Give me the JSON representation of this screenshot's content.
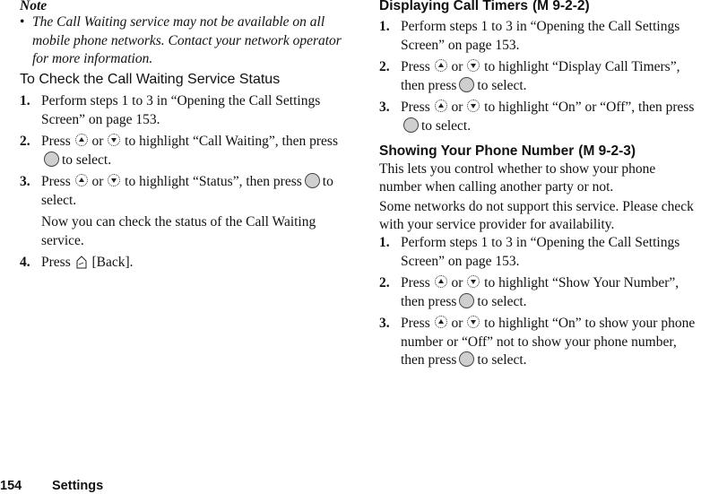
{
  "note": {
    "title": "Note",
    "bullet": "•",
    "text": "The Call Waiting service may not be available on all mobile phone networks. Contact your network operator for more information."
  },
  "left_section": {
    "heading": "To Check the Call Waiting Service Status",
    "steps": [
      {
        "num": "1.",
        "text": "Perform steps 1 to 3 in “Opening the Call Settings Screen” on page 153."
      },
      {
        "num": "2.",
        "pre": "Press",
        "or": "or",
        "mid": "to highlight “Call Waiting”, then press",
        "post": "to select."
      },
      {
        "num": "3.",
        "pre": "Press",
        "or": "or",
        "mid": "to highlight “Status”, then press",
        "post": "to select.",
        "sub": "Now you can check the status of the Call Waiting service."
      },
      {
        "num": "4.",
        "pre": "Press",
        "post": "[Back]."
      }
    ]
  },
  "right_section_1": {
    "heading": "Displaying Call Timers",
    "menu_ref": "(M 9-2-2)",
    "steps": [
      {
        "num": "1.",
        "text": "Perform steps 1 to 3 in “Opening the Call Settings Screen” on page 153."
      },
      {
        "num": "2.",
        "pre": "Press",
        "or": "or",
        "mid": "to highlight “Display Call Timers”, then press",
        "post": "to select."
      },
      {
        "num": "3.",
        "pre": "Press",
        "or": "or",
        "mid": "to highlight “On” or “Off”, then press",
        "post": "to select."
      }
    ]
  },
  "right_section_2": {
    "heading": "Showing Your Phone Number",
    "menu_ref": "(M 9-2-3)",
    "paragraphs": [
      "This lets you control whether to show your phone number when calling another party or not.",
      "Some networks do not support this service. Please check with your service provider for availability."
    ],
    "steps": [
      {
        "num": "1.",
        "text": "Perform steps 1 to 3 in “Opening the Call Settings Screen” on page 153."
      },
      {
        "num": "2.",
        "pre": "Press",
        "or": "or",
        "mid": "to highlight “Show Your Number”, then press",
        "post": "to select."
      },
      {
        "num": "3.",
        "pre": "Press",
        "or": "or",
        "mid": "to highlight “On” to show your phone number or “Off” not to show your phone number, then press",
        "post": "to select."
      }
    ]
  },
  "footer": {
    "page_number": "154",
    "section": "Settings"
  },
  "icons": {
    "nav_up": "nav-up-icon",
    "nav_down": "nav-down-icon",
    "center_key": "center-select-key-icon",
    "back_key": "back-key-icon"
  }
}
